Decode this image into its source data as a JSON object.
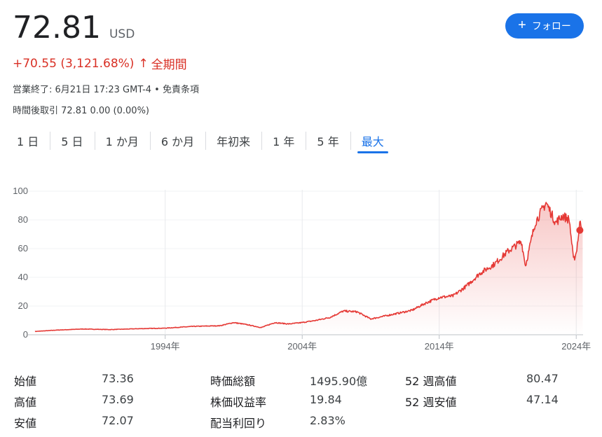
{
  "quote": {
    "price": "72.81",
    "currency": "USD",
    "change_text": "+70.55 (3,121.68%)",
    "change_arrow": "↑",
    "period_label": "全期間",
    "closed_text": "営業終了: 6月21日 17:23 GMT-4 • ",
    "disclaimer_link": "免責条項",
    "after_hours": "時間後取引 72.81 0.00 (0.00%)"
  },
  "follow_button": {
    "plus": "+",
    "label": "フォロー"
  },
  "tabs": [
    {
      "label": "1 日",
      "active": false
    },
    {
      "label": "5 日",
      "active": false
    },
    {
      "label": "1 か月",
      "active": false
    },
    {
      "label": "6 か月",
      "active": false
    },
    {
      "label": "年初来",
      "active": false
    },
    {
      "label": "1 年",
      "active": false
    },
    {
      "label": "5 年",
      "active": false
    },
    {
      "label": "最大",
      "active": true
    }
  ],
  "chart_data": {
    "type": "area",
    "y_ticks": [
      0,
      20,
      40,
      60,
      80,
      100
    ],
    "ylim": [
      0,
      100
    ],
    "x_tick_labels": [
      "1994年",
      "2004年",
      "2014年",
      "2024年"
    ],
    "x_ticks": [
      1994,
      2004,
      2014,
      2024
    ],
    "xlim": [
      1984.5,
      2024.5
    ],
    "grid": true,
    "line_color": "#e53935",
    "fill_color": "#e53935",
    "series": [
      {
        "x": [
          1984.5,
          1986,
          1988,
          1990,
          1992,
          1994,
          1996,
          1998,
          1999,
          2000,
          2001,
          2002,
          2003,
          2004,
          2005,
          2006,
          2007,
          2008,
          2009,
          2010,
          2011,
          2012,
          2013,
          2014,
          2015,
          2016,
          2017,
          2018,
          2019,
          2020,
          2020.3,
          2021,
          2021.8,
          2022,
          2022.5,
          2023,
          2023.5,
          2023.8,
          2024,
          2024.3,
          2024.47
        ],
        "y": [
          2.3,
          3.2,
          4.0,
          3.6,
          4.2,
          4.6,
          5.8,
          6.3,
          8.5,
          7.0,
          5.0,
          8.5,
          7.5,
          8.5,
          10,
          12,
          16.5,
          16,
          11,
          13,
          15,
          17,
          22,
          26,
          27,
          34,
          43,
          49,
          58,
          65,
          48,
          78,
          92,
          88,
          78,
          83,
          80,
          52,
          57,
          80,
          72.8
        ]
      }
    ]
  },
  "stats": [
    {
      "label": "始値",
      "value": "73.36"
    },
    {
      "label": "高値",
      "value": "73.69"
    },
    {
      "label": "安値",
      "value": "72.07"
    },
    {
      "label": "時価総額",
      "value": "1495.90億"
    },
    {
      "label": "株価収益率",
      "value": "19.84"
    },
    {
      "label": "配当利回り",
      "value": "2.83%"
    },
    {
      "label": "52 週高値",
      "value": "80.47"
    },
    {
      "label": "52 週安値",
      "value": "47.14"
    }
  ]
}
